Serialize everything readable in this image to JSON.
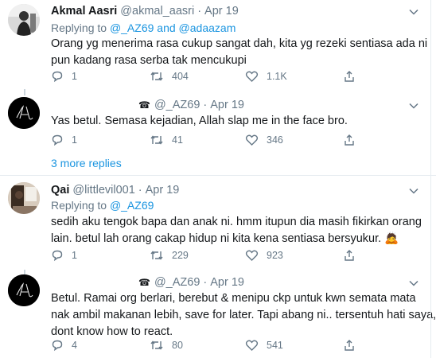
{
  "tweets": [
    {
      "name": "Akmal Aasri",
      "handle": "@akmal_aasri",
      "date": "Apr 19",
      "replying_prefix": "Replying to",
      "replying_a": "@_AZ69",
      "replying_and": "and",
      "replying_b": "@adaazam",
      "lines": [
        "Orang yg menerima rasa cukup sangat dah, kita yg rezeki sentiasa ada ni",
        "pun kadang rasa serba tak mencukupi"
      ],
      "replies": "1",
      "retweets": "404",
      "likes": "1.1K"
    },
    {
      "name": "",
      "handle": "@_AZ69",
      "date": "Apr 19",
      "phone_glyph": "☎",
      "lines": [
        "Yas betul. Semasa kejadian, Allah slap me in the face bro."
      ],
      "replies": "1",
      "retweets": "41",
      "likes": "346"
    },
    {
      "name": "Qai",
      "handle": "@littlevil001",
      "date": "Apr 19",
      "replying_prefix": "Replying to",
      "replying_a": "@_AZ69",
      "lines": [
        "sedih aku tengok bapa dan anak ni. hmm itupun dia masih fikirkan orang",
        "lain. betul lah orang cakap hidup ni kita kena sentiasa bersyukur. 🙇"
      ],
      "replies": "1",
      "retweets": "229",
      "likes": "923"
    },
    {
      "name": "",
      "handle": "@_AZ69",
      "date": "Apr 19",
      "phone_glyph": "☎",
      "lines": [
        "Betul. Ramai org berlari, berebut & menipu ckp untuk kwn semata mata",
        "nak ambil makanan lebih, save for later. Tapi abang ni.. tersentuh hati saya,",
        "dont know how to react."
      ],
      "replies": "4",
      "retweets": "80",
      "likes": "541"
    }
  ],
  "more_replies": "3 more replies",
  "colors": {
    "link": "#1b95e0",
    "muted": "#657786",
    "text": "#14171a",
    "divider": "#e6ecf0",
    "thread": "#ccd6dd"
  },
  "icons": [
    "reply-icon",
    "retweet-icon",
    "like-icon",
    "share-icon",
    "chevron-down-icon",
    "phone-icon"
  ]
}
